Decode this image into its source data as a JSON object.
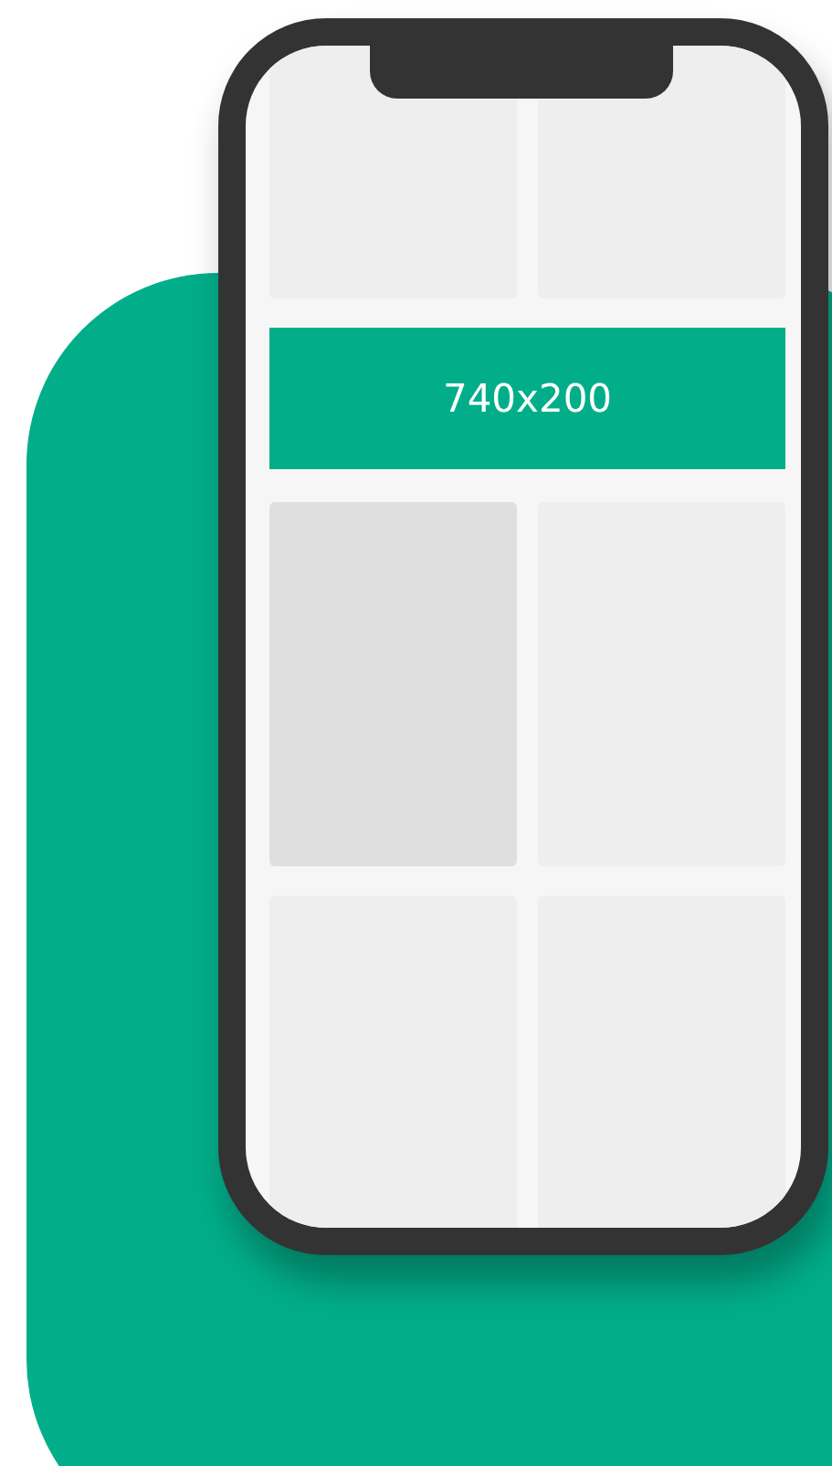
{
  "sections": [
    {
      "kind": "cards",
      "cards": [
        {
          "color": "#eeeeee"
        },
        {
          "color": "#eeeeee"
        }
      ]
    },
    {
      "kind": "banner",
      "text": "740x200"
    },
    {
      "kind": "cards",
      "cards": [
        {
          "color": "#dfdfdf"
        },
        {
          "color": "#eeeeee"
        }
      ]
    },
    {
      "kind": "cards",
      "cards": [
        {
          "color": "#eeeeee"
        },
        {
          "color": "#eeeeee"
        }
      ]
    }
  ]
}
